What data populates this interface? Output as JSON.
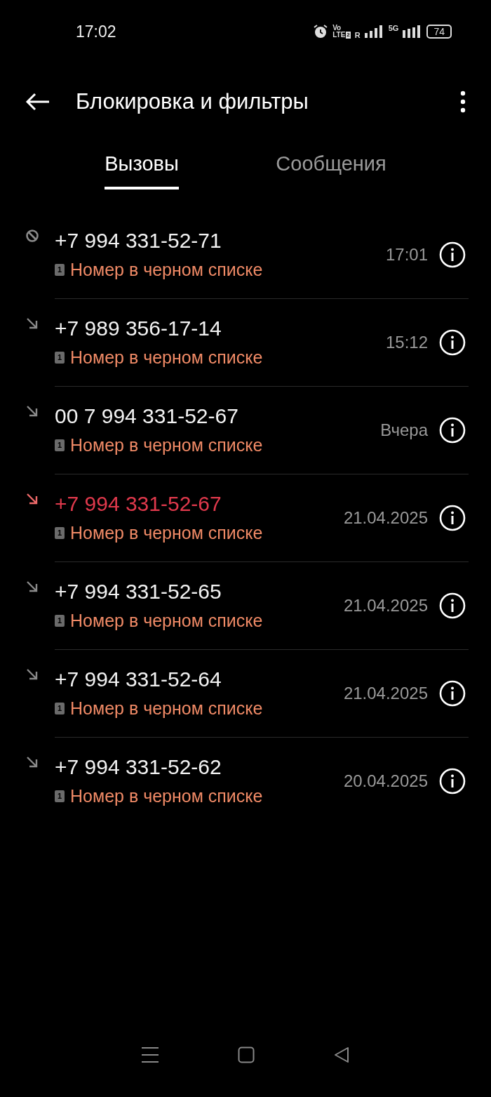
{
  "status_bar": {
    "time": "17:02",
    "volte": "Vo",
    "lte": "LTE",
    "sim": "2",
    "roaming": "R",
    "network": "5G",
    "battery": "74"
  },
  "header": {
    "title": "Блокировка и фильтры"
  },
  "tabs": [
    {
      "label": "Вызовы",
      "selected": true
    },
    {
      "label": "Сообщения",
      "selected": false
    }
  ],
  "calls": [
    {
      "kind": "blocked",
      "number": "+7 994 331-52-71",
      "sim": "1",
      "note": "Номер в черном списке",
      "time": "17:01"
    },
    {
      "kind": "incoming",
      "number": "+7 989 356-17-14",
      "sim": "1",
      "note": "Номер в черном списке",
      "time": "15:12"
    },
    {
      "kind": "incoming",
      "number": "00 7 994 331-52-67",
      "sim": "1",
      "note": "Номер в черном списке",
      "time": "Вчера"
    },
    {
      "kind": "missed",
      "number": "+7 994 331-52-67",
      "sim": "1",
      "note": "Номер в черном списке",
      "time": "21.04.2025"
    },
    {
      "kind": "incoming",
      "number": "+7 994 331-52-65",
      "sim": "1",
      "note": "Номер в черном списке",
      "time": "21.04.2025"
    },
    {
      "kind": "incoming",
      "number": "+7 994 331-52-64",
      "sim": "1",
      "note": "Номер в черном списке",
      "time": "21.04.2025"
    },
    {
      "kind": "incoming",
      "number": "+7 994 331-52-62",
      "sim": "1",
      "note": "Номер в черном списке",
      "time": "20.04.2025"
    }
  ]
}
